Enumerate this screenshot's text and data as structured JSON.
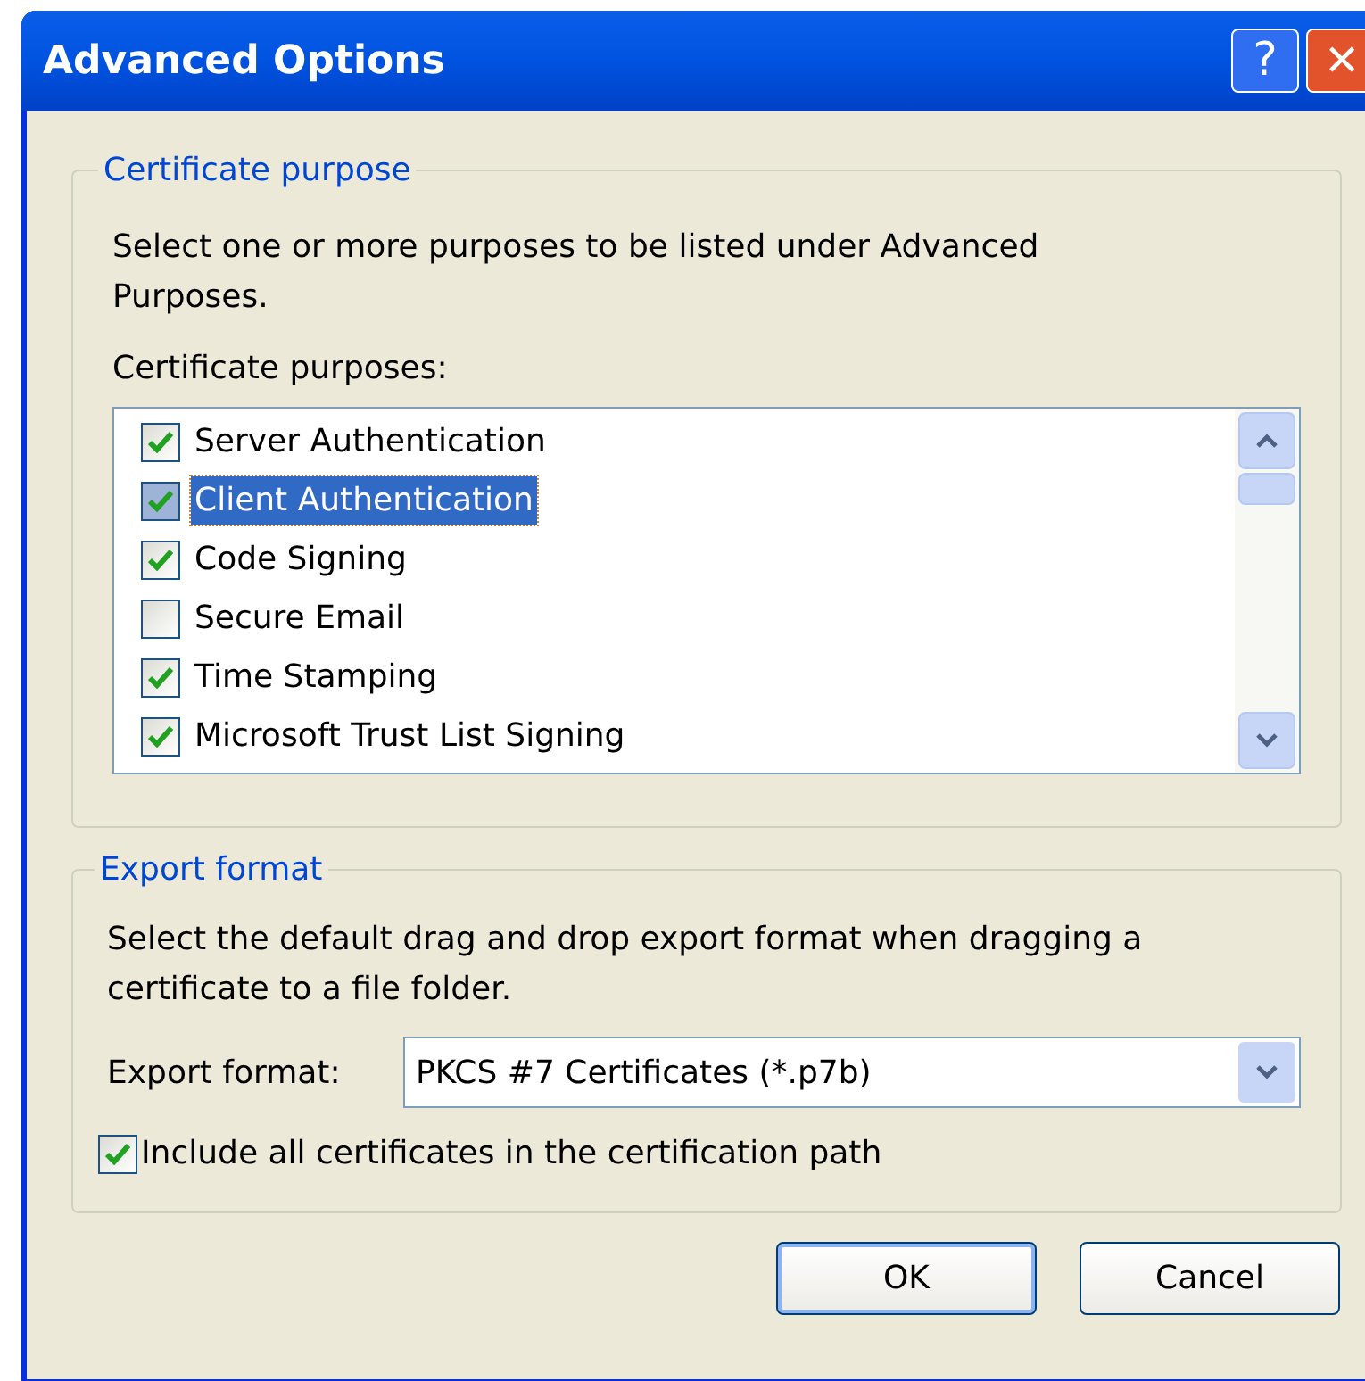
{
  "window": {
    "title": "Advanced Options",
    "help_button": "?",
    "close_button": "✕"
  },
  "certificate_purpose": {
    "group_title": "Certificate purpose",
    "description": "Select one or more purposes to be listed under Advanced Purposes.",
    "list_label": "Certificate purposes:",
    "items": [
      {
        "label": "Server Authentication",
        "checked": true,
        "selected": false
      },
      {
        "label": "Client Authentication",
        "checked": true,
        "selected": true
      },
      {
        "label": "Code Signing",
        "checked": true,
        "selected": false
      },
      {
        "label": "Secure Email",
        "checked": false,
        "selected": false
      },
      {
        "label": "Time Stamping",
        "checked": true,
        "selected": false
      },
      {
        "label": "Microsoft Trust List Signing",
        "checked": true,
        "selected": false
      }
    ]
  },
  "export_format": {
    "group_title": "Export format",
    "description": "Select the default drag and drop export format when dragging a certificate to a file folder.",
    "field_label": "Export format:",
    "value": "PKCS #7 Certificates (*.p7b)",
    "include_all": {
      "label": "Include all certificates in the certification path",
      "checked": true
    }
  },
  "buttons": [
    {
      "label": "OK",
      "default": true
    },
    {
      "label": "Cancel",
      "default": false
    }
  ]
}
